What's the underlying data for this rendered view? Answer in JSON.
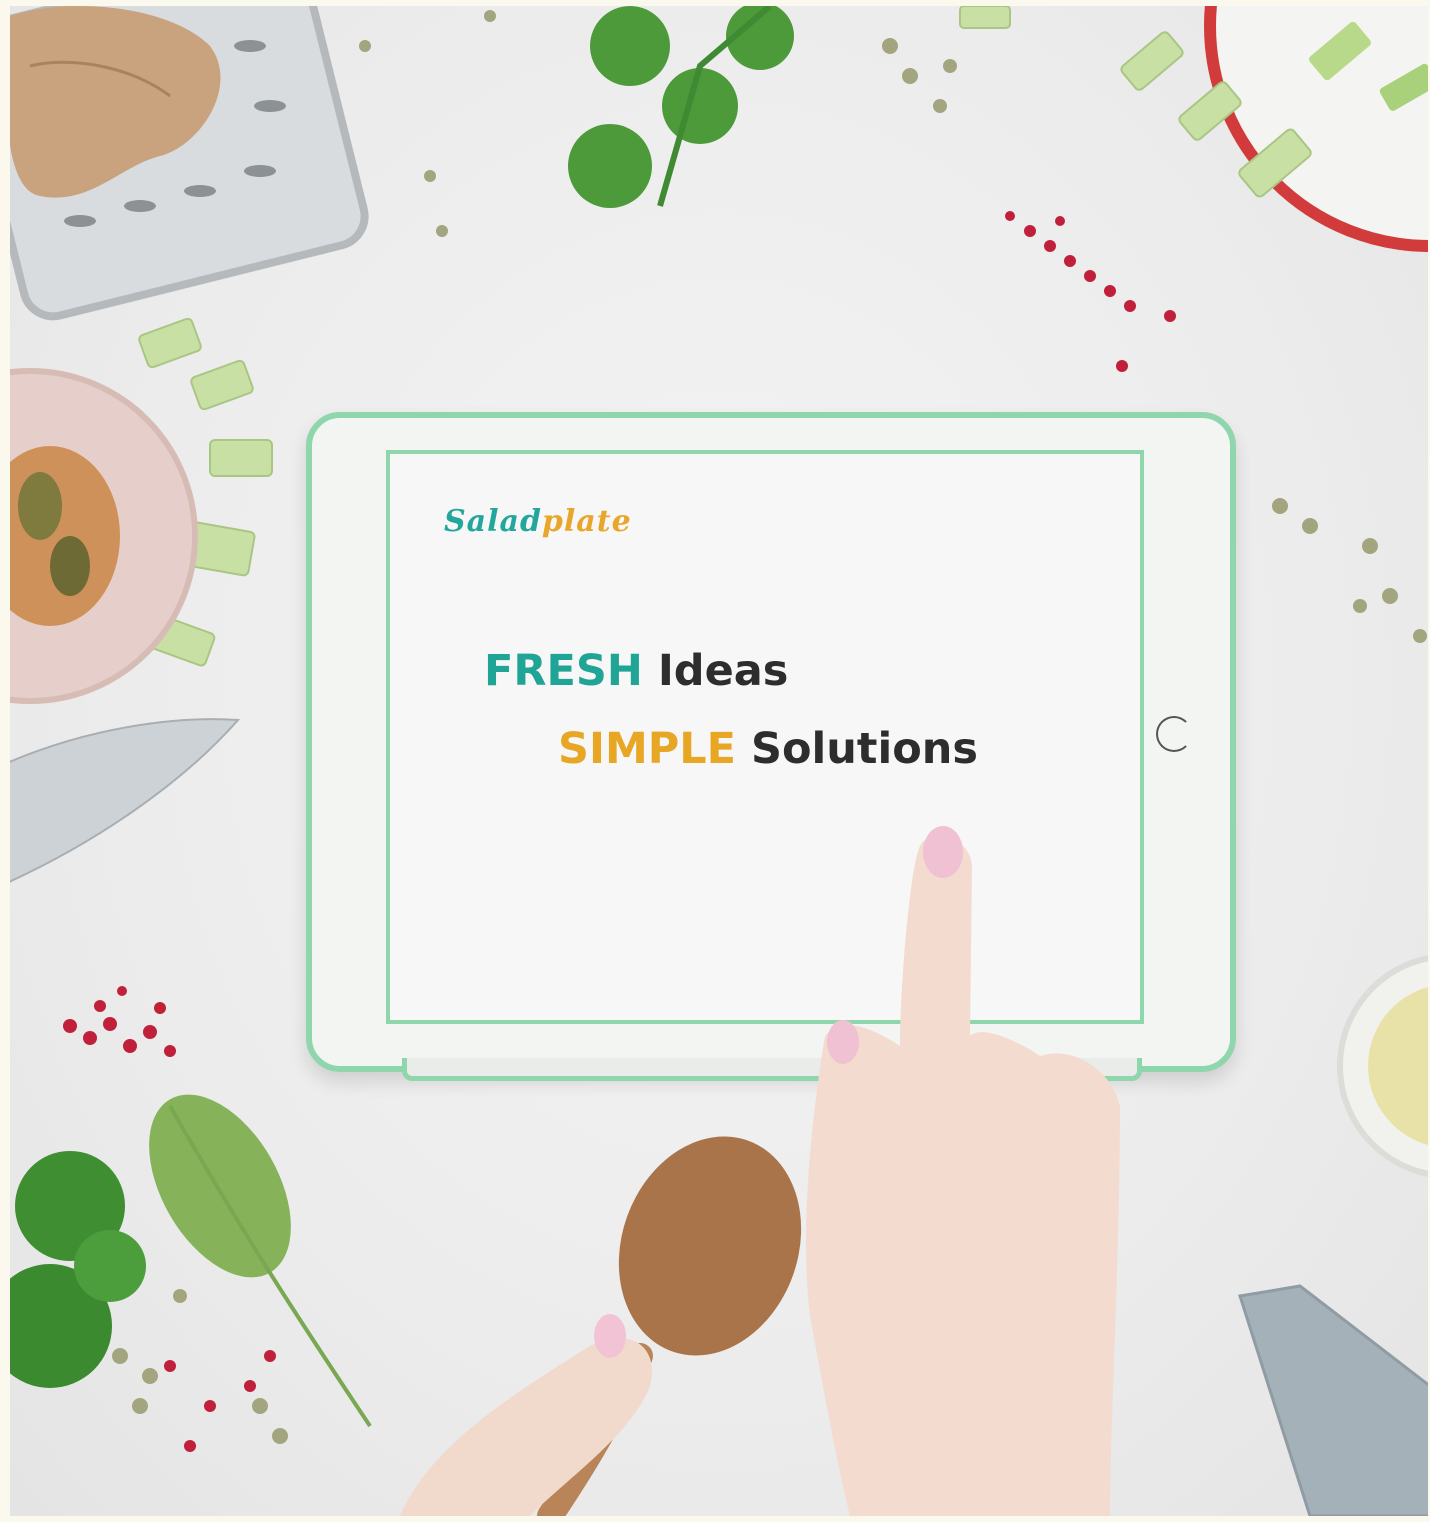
{
  "logo": {
    "part1": "Salad",
    "part2": "plate"
  },
  "headline": {
    "line1_keyword": "FRESH",
    "line1_rest": "Ideas",
    "line2_keyword": "SIMPLE",
    "line2_rest": "Solutions"
  },
  "colors": {
    "background": "#ececec",
    "tablet_case": "#8fd6ad",
    "brand_teal": "#1fa495",
    "brand_gold": "#e7a623",
    "text_dark": "#2d2d2d"
  }
}
